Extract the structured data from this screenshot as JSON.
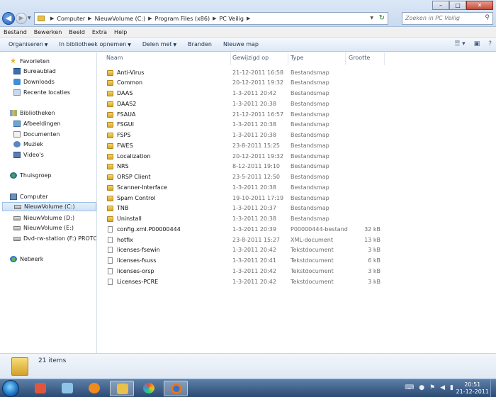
{
  "address": {
    "crumbs": [
      "Computer",
      "NieuwVolume (C:)",
      "Program Files (x86)",
      "PC Veilig"
    ]
  },
  "search": {
    "placeholder": "Zoeken in PC Veilig"
  },
  "menu": [
    "Bestand",
    "Bewerken",
    "Beeld",
    "Extra",
    "Help"
  ],
  "toolbar": {
    "organize": "Organiseren",
    "library": "In bibliotheek opnemen",
    "share": "Delen met",
    "burn": "Branden",
    "new_folder": "Nieuwe map"
  },
  "nav": {
    "favorites": "Favorieten",
    "desktop": "Bureaublad",
    "downloads": "Downloads",
    "recent": "Recente locaties",
    "libraries": "Bibliotheken",
    "pictures": "Afbeeldingen",
    "documents": "Documenten",
    "music": "Muziek",
    "videos": "Video's",
    "homegroup": "Thuisgroep",
    "computer": "Computer",
    "drive_c": "NieuwVolume (C:)",
    "drive_d": "NieuwVolume (D:)",
    "drive_e": "NieuwVolume (E:)",
    "drive_f": "Dvd-rw-station (F:) PROTOTY",
    "network": "Netwerk"
  },
  "columns": {
    "name": "Naam",
    "date": "Gewijzigd op",
    "type": "Type",
    "size": "Grootte"
  },
  "files": [
    {
      "name": "Anti-Virus",
      "date": "21-12-2011 16:58",
      "type": "Bestandsmap",
      "size": "",
      "kind": "folder"
    },
    {
      "name": "Common",
      "date": "20-12-2011 19:32",
      "type": "Bestandsmap",
      "size": "",
      "kind": "folder"
    },
    {
      "name": "DAAS",
      "date": "1-3-2011 20:42",
      "type": "Bestandsmap",
      "size": "",
      "kind": "folder"
    },
    {
      "name": "DAAS2",
      "date": "1-3-2011 20:38",
      "type": "Bestandsmap",
      "size": "",
      "kind": "folder"
    },
    {
      "name": "FSAUA",
      "date": "21-12-2011 16:57",
      "type": "Bestandsmap",
      "size": "",
      "kind": "folder"
    },
    {
      "name": "FSGUI",
      "date": "1-3-2011 20:38",
      "type": "Bestandsmap",
      "size": "",
      "kind": "folder"
    },
    {
      "name": "FSPS",
      "date": "1-3-2011 20:38",
      "type": "Bestandsmap",
      "size": "",
      "kind": "folder"
    },
    {
      "name": "FWES",
      "date": "23-8-2011 15:25",
      "type": "Bestandsmap",
      "size": "",
      "kind": "folder"
    },
    {
      "name": "Localization",
      "date": "20-12-2011 19:32",
      "type": "Bestandsmap",
      "size": "",
      "kind": "folder"
    },
    {
      "name": "NRS",
      "date": "8-12-2011 19:10",
      "type": "Bestandsmap",
      "size": "",
      "kind": "folder"
    },
    {
      "name": "ORSP Client",
      "date": "23-5-2011 12:50",
      "type": "Bestandsmap",
      "size": "",
      "kind": "folder"
    },
    {
      "name": "Scanner-Interface",
      "date": "1-3-2011 20:38",
      "type": "Bestandsmap",
      "size": "",
      "kind": "folder"
    },
    {
      "name": "Spam Control",
      "date": "19-10-2011 17:19",
      "type": "Bestandsmap",
      "size": "",
      "kind": "folder"
    },
    {
      "name": "TNB",
      "date": "1-3-2011 20:37",
      "type": "Bestandsmap",
      "size": "",
      "kind": "folder"
    },
    {
      "name": "Uninstall",
      "date": "1-3-2011 20:38",
      "type": "Bestandsmap",
      "size": "",
      "kind": "folder"
    },
    {
      "name": "config.xml.P00000444",
      "date": "1-3-2011 20:39",
      "type": "P00000444-bestand",
      "size": "32 kB",
      "kind": "file"
    },
    {
      "name": "hotfix",
      "date": "23-8-2011 15:27",
      "type": "XML-document",
      "size": "13 kB",
      "kind": "file"
    },
    {
      "name": "licenses-fsewin",
      "date": "1-3-2011 20:42",
      "type": "Tekstdocument",
      "size": "3 kB",
      "kind": "file"
    },
    {
      "name": "licenses-fsuss",
      "date": "1-3-2011 20:41",
      "type": "Tekstdocument",
      "size": "6 kB",
      "kind": "file"
    },
    {
      "name": "licenses-orsp",
      "date": "1-3-2011 20:42",
      "type": "Tekstdocument",
      "size": "3 kB",
      "kind": "file"
    },
    {
      "name": "Licenses-PCRE",
      "date": "1-3-2011 20:42",
      "type": "Tekstdocument",
      "size": "3 kB",
      "kind": "file"
    }
  ],
  "status": {
    "count": "21 items"
  },
  "clock": {
    "time": "20:51",
    "date": "21-12-2011"
  },
  "colors": {
    "accent": "#3c7fb1",
    "selection": "#cfe2f6",
    "folder": "#e8c04a"
  },
  "icons": [
    "back-arrow-icon",
    "forward-arrow-icon",
    "refresh-icon",
    "search-icon",
    "star-icon",
    "folder-icon",
    "document-icon",
    "drive-icon",
    "network-icon"
  ]
}
